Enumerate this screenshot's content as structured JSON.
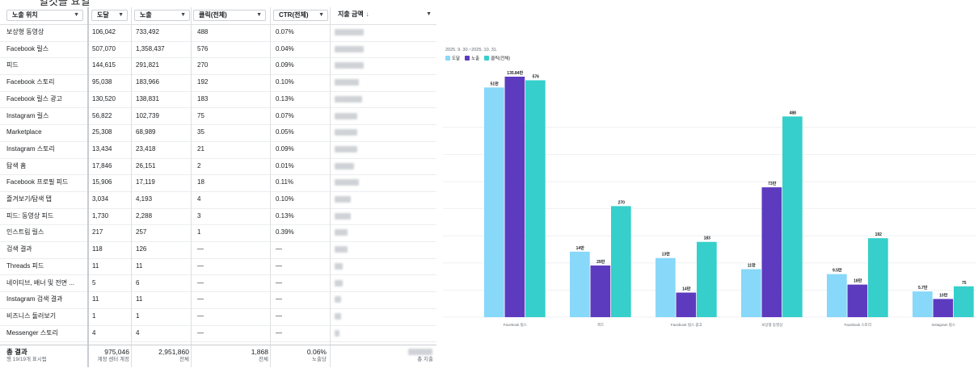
{
  "top_text": "일것을 요일",
  "table": {
    "columns": [
      {
        "label": "노출 위치"
      },
      {
        "label": "도달"
      },
      {
        "label": "노출"
      },
      {
        "label": "클릭(전체)"
      },
      {
        "label": "CTR(전체)"
      },
      {
        "label": "지출 금액",
        "sorted": "desc",
        "sort_icon": "↓"
      }
    ],
    "rows": [
      {
        "placement": "보상형 동영상",
        "reach": "106,042",
        "impressions": "733,492",
        "clicks": "488",
        "ctr": "0.07%"
      },
      {
        "placement": "Facebook 릴스",
        "reach": "507,070",
        "impressions": "1,358,437",
        "clicks": "576",
        "ctr": "0.04%"
      },
      {
        "placement": "피드",
        "reach": "144,615",
        "impressions": "291,821",
        "clicks": "270",
        "ctr": "0.09%"
      },
      {
        "placement": "Facebook 스토리",
        "reach": "95,038",
        "impressions": "183,966",
        "clicks": "192",
        "ctr": "0.10%"
      },
      {
        "placement": "Facebook 릴스 광고",
        "reach": "130,520",
        "impressions": "138,831",
        "clicks": "183",
        "ctr": "0.13%"
      },
      {
        "placement": "Instagram 릴스",
        "reach": "56,822",
        "impressions": "102,739",
        "clicks": "75",
        "ctr": "0.07%"
      },
      {
        "placement": "Marketplace",
        "reach": "25,308",
        "impressions": "68,989",
        "clicks": "35",
        "ctr": "0.05%"
      },
      {
        "placement": "Instagram 스토리",
        "reach": "13,434",
        "impressions": "23,418",
        "clicks": "21",
        "ctr": "0.09%"
      },
      {
        "placement": "탐색 홈",
        "reach": "17,846",
        "impressions": "26,151",
        "clicks": "2",
        "ctr": "0.01%"
      },
      {
        "placement": "Facebook 프로필 피드",
        "reach": "15,906",
        "impressions": "17,119",
        "clicks": "18",
        "ctr": "0.11%"
      },
      {
        "placement": "즐겨보기/탐색 탭",
        "reach": "3,034",
        "impressions": "4,193",
        "clicks": "4",
        "ctr": "0.10%"
      },
      {
        "placement": "피드: 동영상 피드",
        "reach": "1,730",
        "impressions": "2,288",
        "clicks": "3",
        "ctr": "0.13%"
      },
      {
        "placement": "인스트림 릴스",
        "reach": "217",
        "impressions": "257",
        "clicks": "1",
        "ctr": "0.39%"
      },
      {
        "placement": "검색 결과",
        "reach": "118",
        "impressions": "126",
        "clicks": "—",
        "ctr": "—"
      },
      {
        "placement": "Threads 피드",
        "reach": "11",
        "impressions": "11",
        "clicks": "—",
        "ctr": "—"
      },
      {
        "placement": "네이티브, 배너 및 전면 ...",
        "reach": "5",
        "impressions": "6",
        "clicks": "—",
        "ctr": "—"
      },
      {
        "placement": "Instagram 검색 결과",
        "reach": "11",
        "impressions": "11",
        "clicks": "—",
        "ctr": "—"
      },
      {
        "placement": "비즈니스 둘러보기",
        "reach": "1",
        "impressions": "1",
        "clicks": "—",
        "ctr": "—"
      },
      {
        "placement": "Messenger 스토리",
        "reach": "4",
        "impressions": "4",
        "clicks": "—",
        "ctr": "—"
      }
    ],
    "total": {
      "label": "총 결과",
      "sublabel": "행 19/19개 표시됨",
      "reach": "975,046",
      "reach_sub": "계정 센터 계정",
      "impressions": "2,951,860",
      "impressions_sub": "전체",
      "clicks": "1,868",
      "clicks_sub": "전체",
      "ctr": "0.06%",
      "ctr_sub": "노출당",
      "spend_sub": "총 지출"
    }
  },
  "chart_data": {
    "type": "bar",
    "date_range": "2025. 9. 30.~2025. 10. 31.",
    "categories": [
      "Facebook 릴스",
      "피드",
      "Facebook 릴스 광고",
      "보상형 동영상",
      "Facebook 스토리",
      "Instagram 릴스"
    ],
    "series": [
      {
        "name": "도달",
        "color": "#88d8fa",
        "values": [
          507070,
          144615,
          130520,
          106042,
          95038,
          56822
        ],
        "labels": [
          "51만",
          "14만",
          "13만",
          "11만",
          "9.5만",
          "5.7만"
        ]
      },
      {
        "name": "노출",
        "color": "#5d3bbf",
        "values": [
          1358437,
          291821,
          138831,
          733492,
          183966,
          102739
        ],
        "labels": [
          "135.84만",
          "29만",
          "14만",
          "73만",
          "18만",
          "10만"
        ]
      },
      {
        "name": "클릭(전체)",
        "color": "#36cfcb",
        "values": [
          576,
          270,
          183,
          488,
          192,
          75
        ],
        "labels": [
          "576",
          "270",
          "183",
          "488",
          "192",
          "75"
        ]
      }
    ],
    "grid": true,
    "legend": "top-left"
  }
}
